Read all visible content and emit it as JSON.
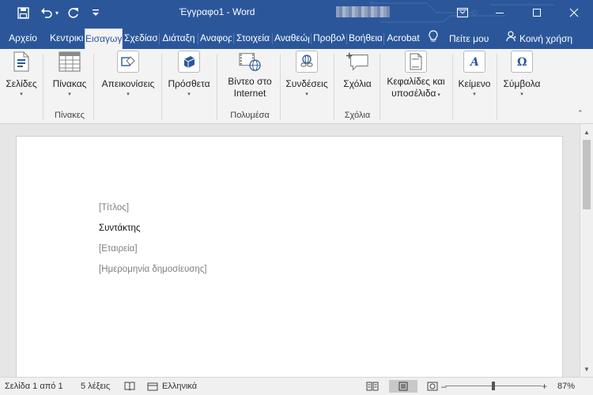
{
  "titlebar": {
    "doc_title": "Έγγραφο1  -  Word",
    "accent": "#2b579a"
  },
  "quick_access": [
    "save-icon",
    "undo-icon",
    "redo-icon",
    "customize-icon"
  ],
  "tabs": [
    {
      "label": "Αρχείο"
    },
    {
      "label": "Κεντρική"
    },
    {
      "label": "Εισαγωγή"
    },
    {
      "label": "Σχεδίαση"
    },
    {
      "label": "Διάταξη"
    },
    {
      "label": "Αναφορές"
    },
    {
      "label": "Στοιχεία"
    },
    {
      "label": "Αναθεώρηση"
    },
    {
      "label": "Προβολή"
    },
    {
      "label": "Βοήθεια"
    },
    {
      "label": "Acrobat"
    }
  ],
  "tell_me": "Πείτε μου",
  "share": "Κοινή χρήση",
  "ribbon": {
    "pages": "Σελίδες",
    "table": "Πίνακας",
    "tables_group": "Πίνακες",
    "illustrations": "Απεικονίσεις",
    "addins": "Πρόσθετα",
    "online_video": [
      "Βίντεο στο",
      "Internet"
    ],
    "media_group": "Πολυμέσα",
    "links": "Συνδέσεις",
    "comment": "Σχόλια",
    "comments_group": "Σχόλια",
    "header_footer": [
      "Κεφαλίδες και",
      "υποσέλιδα"
    ],
    "text": "Κείμενο",
    "symbols": "Σύμβολα"
  },
  "document": {
    "title_placeholder": "[Τίτλος]",
    "author": "Συντάκτης",
    "company_placeholder": "[Εταιρεία]",
    "date_placeholder": "[Ημερομηνία δημοσίευσης]"
  },
  "status": {
    "page": "Σελίδα 1 από 1",
    "words": "5 λέξεις",
    "language": "Ελληνικά",
    "zoom": "87%"
  }
}
